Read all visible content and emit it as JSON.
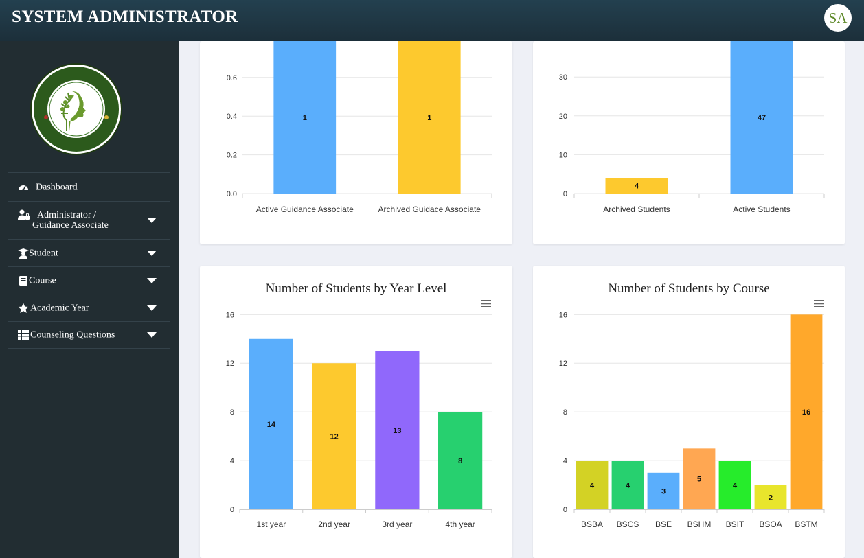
{
  "header": {
    "title": "SYSTEM ADMINISTRATOR",
    "avatar_initials": "SA"
  },
  "sidebar": {
    "logo_icon": "office-of-student-affairs-seal",
    "items": [
      {
        "label": "Dashboard",
        "icon": "gauge-icon",
        "has_caret": false
      },
      {
        "label": "Administrator /",
        "label2": "Guidance Associate",
        "icon": "user-lock-icon",
        "has_caret": true
      },
      {
        "label": "Student",
        "icon": "graduate-icon",
        "has_caret": true
      },
      {
        "label": "Course",
        "icon": "book-icon",
        "has_caret": true
      },
      {
        "label": "Academic Year",
        "icon": "star-icon",
        "has_caret": true
      },
      {
        "label": "Counseling Questions",
        "icon": "table-icon",
        "has_caret": true
      }
    ]
  },
  "chart_data": [
    {
      "type": "bar",
      "title": "",
      "categories": [
        "Active Guidance Associate",
        "Archived Guidace Associate"
      ],
      "values": [
        1,
        1
      ],
      "data_labels": [
        "1",
        "1"
      ],
      "colors": [
        "#5aaefc",
        "#fdc92e"
      ],
      "yticks": [
        "0.0",
        "0.2",
        "0.4",
        "0.6"
      ],
      "ylim": [
        0,
        0.8
      ],
      "grid": true
    },
    {
      "type": "bar",
      "title": "",
      "categories": [
        "Archived Students",
        "Active Students"
      ],
      "values": [
        4,
        47
      ],
      "data_labels": [
        "4",
        "47"
      ],
      "colors": [
        "#fdc92e",
        "#5aaefc"
      ],
      "yticks": [
        "0",
        "10",
        "20",
        "30"
      ],
      "ylim": [
        0,
        40
      ],
      "grid": true
    },
    {
      "type": "bar",
      "title": "Number of Students by Year Level",
      "categories": [
        "1st year",
        "2nd year",
        "3rd year",
        "4th year"
      ],
      "values": [
        14,
        12,
        13,
        8
      ],
      "data_labels": [
        "14",
        "12",
        "13",
        "8"
      ],
      "colors": [
        "#5aaefc",
        "#fdc92e",
        "#9068fb",
        "#27d06f"
      ],
      "yticks": [
        "0",
        "4",
        "8",
        "12",
        "16"
      ],
      "ylim": [
        0,
        16
      ],
      "grid": true
    },
    {
      "type": "bar",
      "title": "Number of Students by Course",
      "categories": [
        "BSBA",
        "BSCS",
        "BSE",
        "BSHM",
        "BSIT",
        "BSOA",
        "BSTM"
      ],
      "values": [
        4,
        4,
        3,
        5,
        4,
        2,
        16
      ],
      "data_labels": [
        "4",
        "4",
        "3",
        "5",
        "4",
        "2",
        "16"
      ],
      "colors": [
        "#d3d225",
        "#27d06f",
        "#5aaefc",
        "#ffa752",
        "#26ec2b",
        "#e8e52c",
        "#ffa82b"
      ],
      "yticks": [
        "0",
        "4",
        "8",
        "12",
        "16"
      ],
      "ylim": [
        0,
        16
      ],
      "grid": true
    }
  ],
  "chart_menu_icon": "hamburger-menu-icon"
}
